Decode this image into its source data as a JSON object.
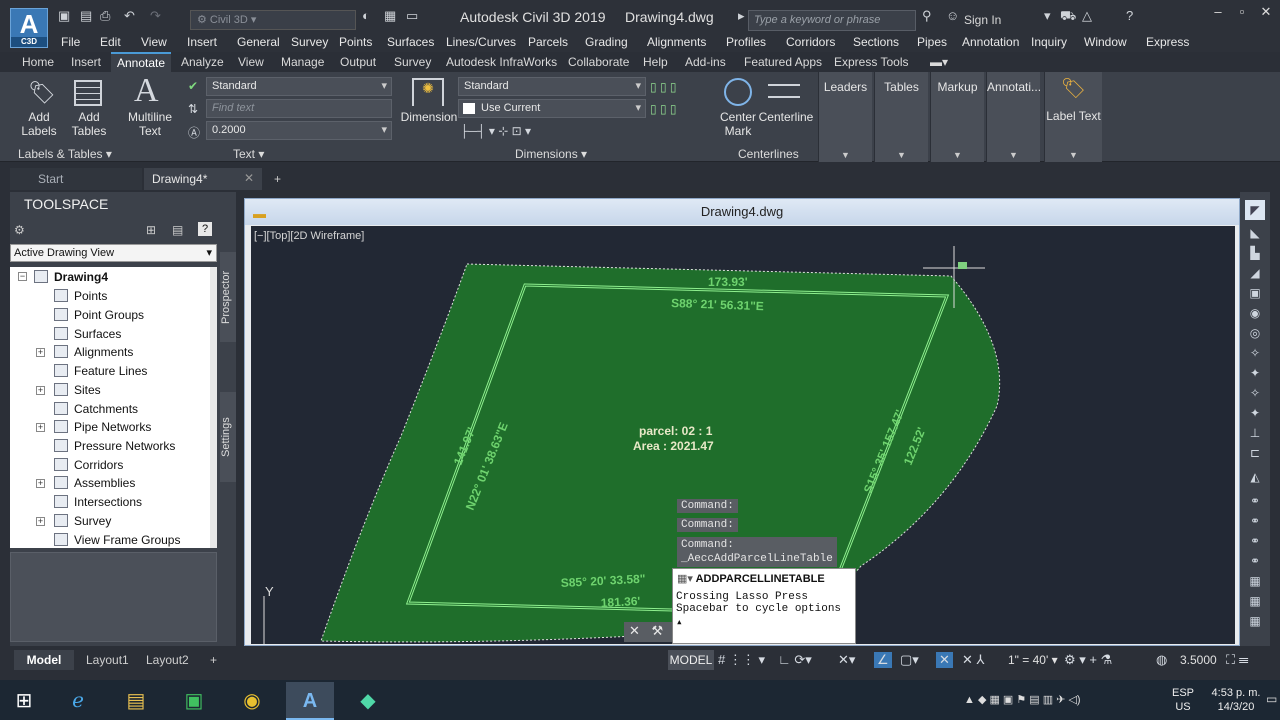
{
  "app": {
    "logo_letter": "A",
    "logo_sub": "C3D",
    "title": "Autodesk Civil 3D 2019",
    "drawing": "Drawing4.dwg",
    "workspace": "Civil 3D",
    "search_placeholder": "Type a keyword or phrase",
    "sign_in": "Sign In"
  },
  "menubar": [
    "File",
    "Edit",
    "View",
    "Insert",
    "General",
    "Survey",
    "Points",
    "Surfaces",
    "Lines/Curves",
    "Parcels",
    "Grading",
    "Alignments",
    "Profiles",
    "Corridors",
    "Sections",
    "Pipes",
    "Annotation",
    "Inquiry",
    "Window",
    "Express"
  ],
  "ribbon_tabs": [
    "Home",
    "Insert",
    "Annotate",
    "Analyze",
    "View",
    "Manage",
    "Output",
    "Survey",
    "Autodesk InfraWorks",
    "Collaborate",
    "Help",
    "Add-ins",
    "Featured Apps",
    "Express Tools"
  ],
  "ribbon": {
    "add_labels": "Add\nLabels",
    "add_tables": "Add\nTables",
    "multiline_text": "Multiline\nText",
    "text_style": "Standard",
    "find_text": "Find text",
    "text_height": "0.2000",
    "dimension": "Dimension",
    "dim_style": "Standard",
    "use_current": "Use Current",
    "center_mark": "Center\nMark",
    "centerline": "Centerline",
    "panel_labels_tables": "Labels & Tables",
    "panel_text": "Text",
    "panel_dimensions": "Dimensions",
    "panel_centerlines": "Centerlines",
    "flyouts": [
      "Leaders",
      "Tables",
      "Markup",
      "Annotati..."
    ],
    "label_text": "Label Text"
  },
  "file_tabs": [
    "Start",
    "Drawing4*"
  ],
  "toolspace": {
    "title": "TOOLSPACE",
    "view": "Active Drawing View",
    "root": "Drawing4",
    "items": [
      "Points",
      "Point Groups",
      "Surfaces",
      "Alignments",
      "Feature Lines",
      "Sites",
      "Catchments",
      "Pipe Networks",
      "Pressure Networks",
      "Corridors",
      "Assemblies",
      "Intersections",
      "Survey",
      "View Frame Groups"
    ],
    "vtabs": [
      "Prospector",
      "Settings"
    ]
  },
  "viewport": {
    "label": "[−][Top][2D Wireframe]",
    "parcel_name": "parcel: 02 : 1",
    "parcel_area": "Area : 2021.47",
    "seg_top_len": "173.93'",
    "seg_top_bearing": "S88° 21' 56.31\"E",
    "seg_left_len": "141.97'",
    "seg_left_bearing": "N22° 01' 38.63\"E",
    "seg_right": "S15° 35' 157.47'",
    "seg_right2": "122.52'",
    "seg_bottom": "S85° 20' 33.58\"",
    "seg_bottom_len": "181.36'",
    "ucs_y": "Y"
  },
  "command": {
    "lines": [
      "Command:",
      "Command:",
      "Command:\n_AeccAddParcelLineTable"
    ],
    "tooltip_title": "ADDPARCELLINETABLE",
    "tooltip_line1": "Crossing Lasso  Press",
    "tooltip_line2": "Spacebar to cycle options"
  },
  "status": {
    "tabs": [
      "Model",
      "Layout1",
      "Layout2"
    ],
    "model": "MODEL",
    "scale": "1\" = 40'",
    "annot": "3.5000"
  },
  "taskbar": {
    "lang1": "ESP",
    "lang2": "US",
    "time": "4:53 p. m.",
    "date": "14/3/20"
  },
  "colors": {
    "parcel_fill": "#1f6e2b",
    "parcel_line": "#8ff08f",
    "canvas_bg": "#222834",
    "accent": "#4a9ad6"
  }
}
